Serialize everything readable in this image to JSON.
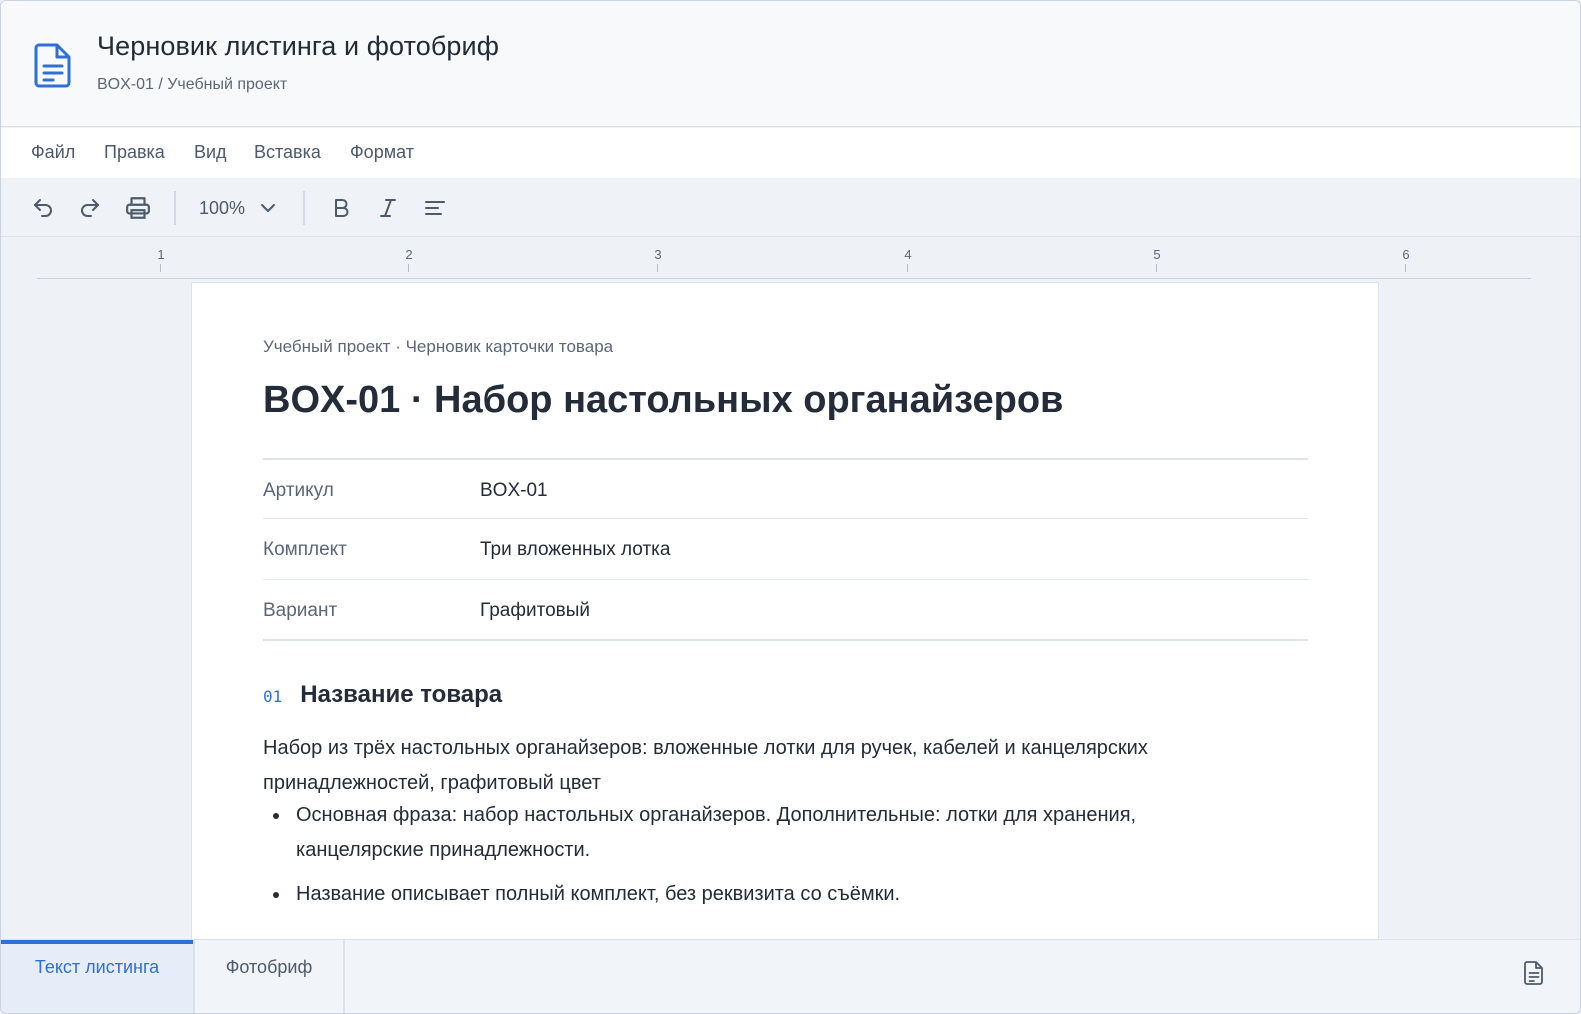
{
  "header": {
    "title": "Черновик листинга и фотобриф",
    "breadcrumb": "BOX-01 / Учебный проект",
    "icon": "document-icon"
  },
  "menu": {
    "items": [
      "Файл",
      "Правка",
      "Вид",
      "Вставка",
      "Формат"
    ]
  },
  "toolbar": {
    "zoom": "100%",
    "icons": [
      "undo-icon",
      "redo-icon",
      "print-icon",
      "chevron-down-icon",
      "bold-icon",
      "italic-icon",
      "align-left-icon"
    ]
  },
  "ruler": {
    "labels": [
      "1",
      "2",
      "3",
      "4",
      "5",
      "6"
    ]
  },
  "document": {
    "eyebrow": "Учебный проект · Черновик карточки товара",
    "title": "BOX-01 · Набор настольных органайзеров",
    "meta": [
      {
        "key": "Артикул",
        "value": "BOX-01"
      },
      {
        "key": "Комплект",
        "value": "Три вложенных лотка"
      },
      {
        "key": "Вариант",
        "value": "Графитовый"
      }
    ],
    "section": {
      "number": "01",
      "title": "Название товара",
      "body": "Набор из трёх настольных органайзеров: вложенные лотки для ручек, кабелей и канцелярских принадлежностей, графитовый цвет",
      "bullets": [
        "Основная фраза: набор настольных органайзеров. Дополнительные: лотки для хранения, канцелярские принадлежности.",
        "Название описывает полный комплект, без реквизита со съёмки."
      ]
    }
  },
  "tabs": {
    "items": [
      "Текст листинга",
      "Фотобриф"
    ],
    "active": 0
  },
  "colors": {
    "accent": "#2f6fd6",
    "text": "#232c38",
    "muted": "#5b6778"
  }
}
